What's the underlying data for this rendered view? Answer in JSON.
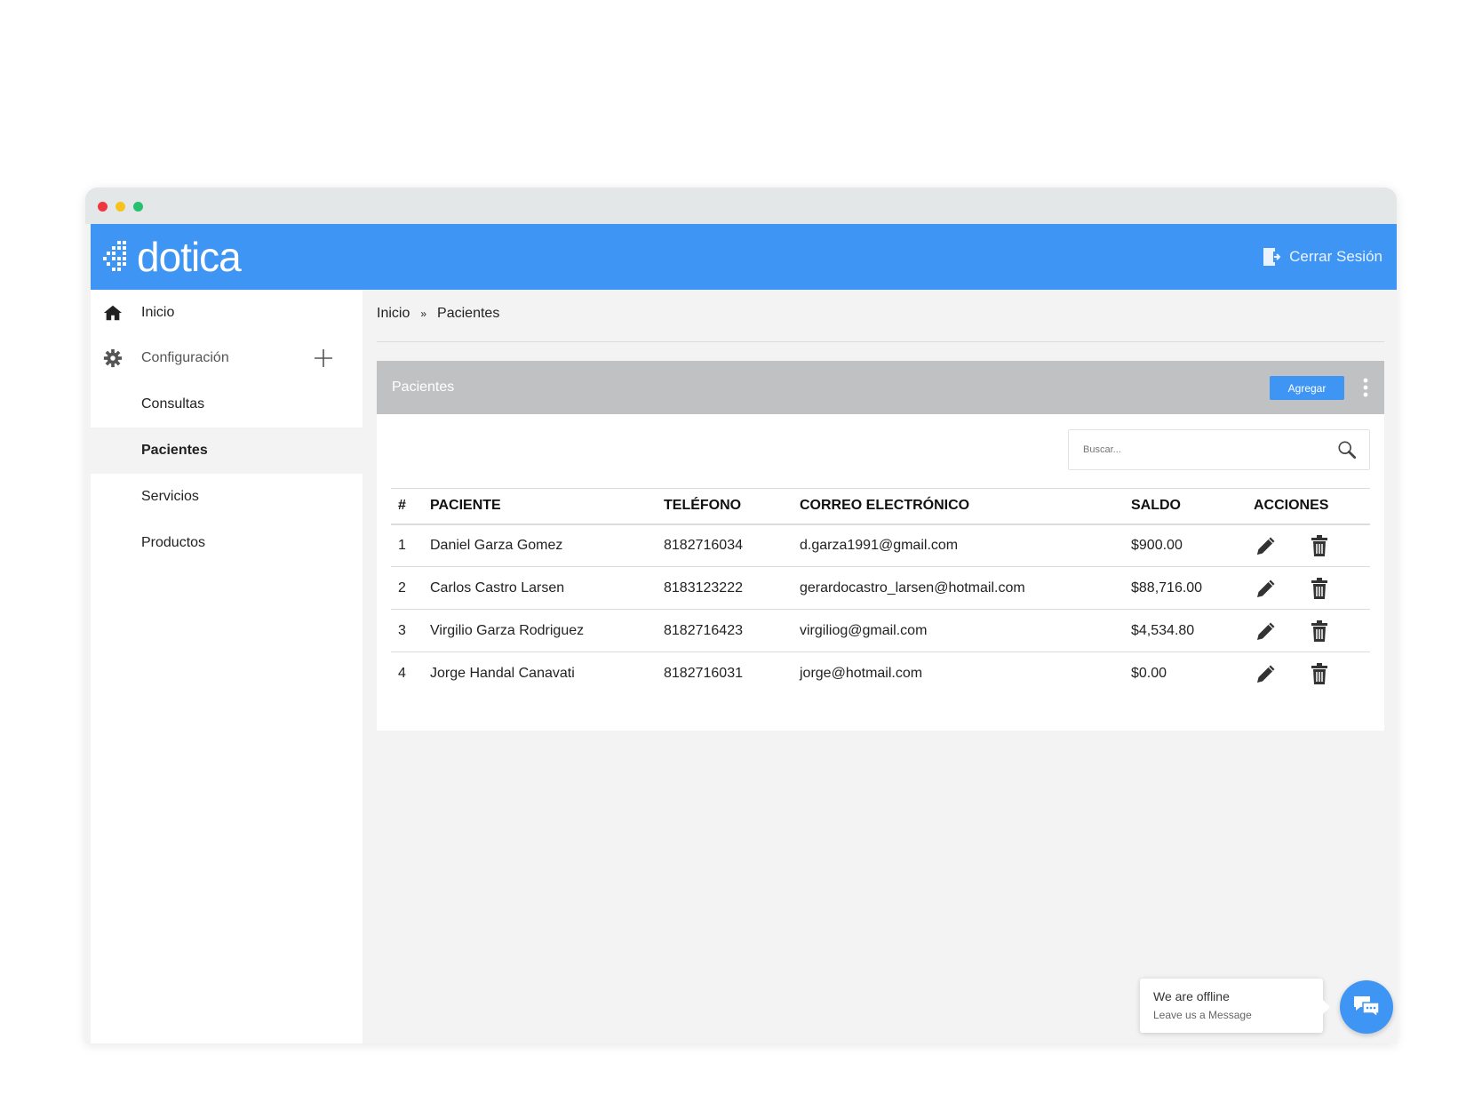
{
  "app": {
    "logo_text": "dotica",
    "logout_label": "Cerrar Sesión",
    "brand_color": "#3f95f3"
  },
  "sidebar": {
    "items": [
      {
        "label": "Inicio",
        "icon": "home-icon"
      },
      {
        "label": "Configuración",
        "icon": "gear-icon",
        "expand_icon": "plus-icon"
      },
      {
        "label": "Consultas"
      },
      {
        "label": "Pacientes",
        "active": true
      },
      {
        "label": "Servicios"
      },
      {
        "label": "Productos"
      }
    ]
  },
  "breadcrumb": {
    "items": [
      "Inicio",
      "Pacientes"
    ],
    "separator": "»"
  },
  "panel": {
    "title": "Pacientes",
    "add_label": "Agregar",
    "search_placeholder": "Buscar..."
  },
  "table": {
    "headers": [
      "#",
      "PACIENTE",
      "TELÉFONO",
      "CORREO ELECTRÓNICO",
      "SALDO",
      "ACCIONES"
    ],
    "rows": [
      {
        "num": "1",
        "name": "Daniel Garza Gomez",
        "phone": "8182716034",
        "email": "d.garza1991@gmail.com",
        "saldo": "$900.00"
      },
      {
        "num": "2",
        "name": "Carlos Castro Larsen",
        "phone": "8183123222",
        "email": "gerardocastro_larsen@hotmail.com",
        "saldo": "$88,716.00"
      },
      {
        "num": "3",
        "name": "Virgilio Garza Rodriguez",
        "phone": "8182716423",
        "email": "virgiliog@gmail.com",
        "saldo": "$4,534.80"
      },
      {
        "num": "4",
        "name": "Jorge Handal Canavati",
        "phone": "8182716031",
        "email": "jorge@hotmail.com",
        "saldo": "$0.00"
      }
    ]
  },
  "chat": {
    "status": "We are offline",
    "cta": "Leave us a Message"
  }
}
